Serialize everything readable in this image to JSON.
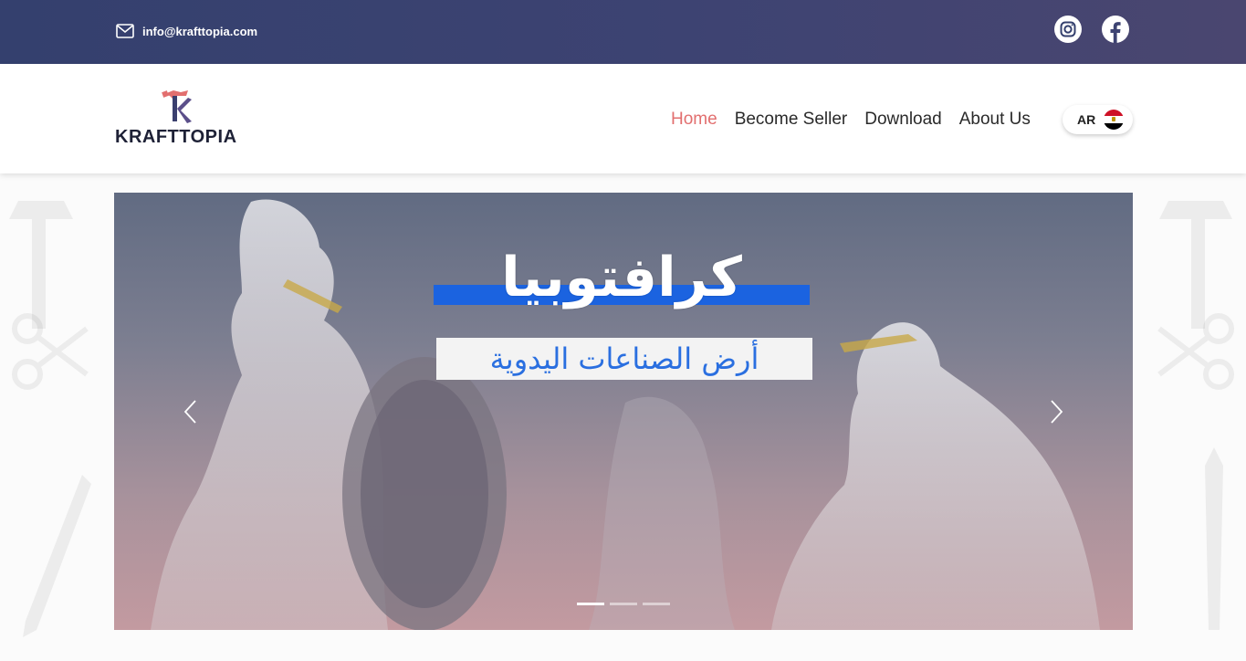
{
  "topbar": {
    "email": "info@krafttopia.com",
    "social": [
      {
        "icon": "instagram-icon"
      },
      {
        "icon": "facebook-icon"
      }
    ]
  },
  "header": {
    "logo_text": "KRAFTTOPIA",
    "nav": [
      {
        "label": "Home",
        "active": true
      },
      {
        "label": "Become Seller",
        "active": false
      },
      {
        "label": "Download",
        "active": false
      },
      {
        "label": "About Us",
        "active": false
      }
    ],
    "language": {
      "code": "AR",
      "flag": "egypt-flag-icon"
    }
  },
  "carousel": {
    "slide_title": "كرافتوبيا",
    "slide_subtitle": "أرض الصناعات اليدوية",
    "prev_icon": "chevron-left-icon",
    "next_icon": "chevron-right-icon",
    "slide_count": 3,
    "active_slide": 0
  },
  "colors": {
    "topbar": "#34406e",
    "accent": "#e26f6f",
    "banner_blue": "#1b63e0"
  }
}
